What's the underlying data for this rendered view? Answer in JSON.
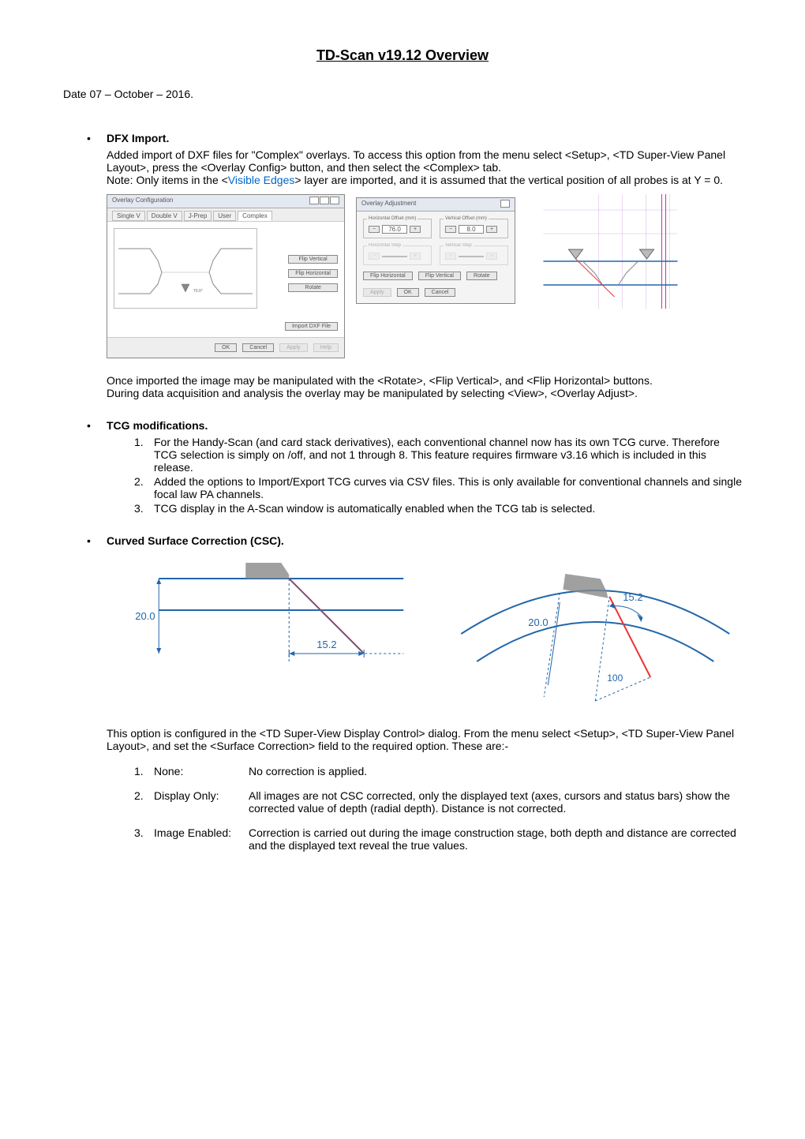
{
  "title": "TD-Scan v19.12 Overview",
  "date_line": "Date   07 – October – 2016.",
  "dfx": {
    "heading": "DFX Import.",
    "p1": "Added import of DXF files for \"Complex\" overlays.  To access this option from the menu select <Setup>, <TD Super-View Panel Layout>, press the <Overlay Config> button, and then select the <Complex> tab.",
    "note_label": "Note:",
    "note_text_pre": "Only items in the <",
    "note_link": "Visible Edges",
    "note_text_post": "> layer are imported, and it is assumed that the vertical position of all probes is at Y = 0.",
    "p2": "Once imported the image may be manipulated with the <Rotate>, <Flip Vertical>, and <Flip Horizontal> buttons.",
    "p3": "During data acquisition and analysis the overlay may be manipulated by selecting <View>, <Overlay Adjust>."
  },
  "overlay_dialog": {
    "title": "Overlay Configuration",
    "tabs": [
      "Single V",
      "Double V",
      "J-Prep",
      "User",
      "Complex"
    ],
    "selected_tab": "Complex",
    "btn_flip_v": "Flip Vertical",
    "btn_flip_h": "Flip Horizontal",
    "btn_rotate": "Rotate",
    "btn_import": "Import DXF File",
    "btn_ok": "OK",
    "btn_cancel": "Cancel",
    "btn_apply": "Apply",
    "btn_help": "Help"
  },
  "adjust_dialog": {
    "title": "Overlay Adjustment",
    "h_offset_label": "Horizontal Offset (mm)",
    "v_offset_label": "Vertical Offset (mm)",
    "h_offset_val": "76.0",
    "v_offset_val": "8.0",
    "h_step_label": "Horizontal Step",
    "v_step_label": "Vertical Step",
    "btn_flip_h": "Flip Horizontal",
    "btn_flip_v": "Flip Vertical",
    "btn_rotate": "Rotate",
    "btn_apply": "Apply",
    "btn_ok": "OK",
    "btn_cancel": "Cancel"
  },
  "tcg": {
    "heading": "TCG modifications.",
    "items": [
      "For the Handy-Scan (and card stack derivatives), each conventional channel now has its own TCG curve.  Therefore TCG selection is simply on /off, and not 1 through 8.  This feature requires firmware v3.16 which is included in this release.",
      "Added the options to Import/Export TCG curves via CSV files.  This is only available for conventional channels and single focal law PA channels.",
      "TCG display in the A-Scan window is automatically enabled when the TCG tab is selected."
    ]
  },
  "csc": {
    "heading": "Curved Surface Correction (CSC).",
    "left_dim1": "20.0",
    "left_dim2": "15.2",
    "right_dim1": "20.0",
    "right_dim2": "15.2",
    "right_r": "100",
    "p1": "This option is configured in the <TD Super-View Display Control> dialog.  From the menu select <Setup>, <TD Super-View Panel Layout>, and set the <Surface Correction> field to the required option.  These are:-",
    "options": [
      {
        "num": "1.",
        "label": "None:",
        "desc": "No correction is applied."
      },
      {
        "num": "2.",
        "label": "Display Only:",
        "desc": "All images are not CSC corrected, only the displayed text (axes, cursors and status bars) show the corrected value of depth (radial depth).  Distance is not corrected."
      },
      {
        "num": "3.",
        "label": "Image Enabled:",
        "desc": "Correction is carried out during the image construction stage, both depth and distance are corrected and the displayed text reveal the true values."
      }
    ]
  }
}
